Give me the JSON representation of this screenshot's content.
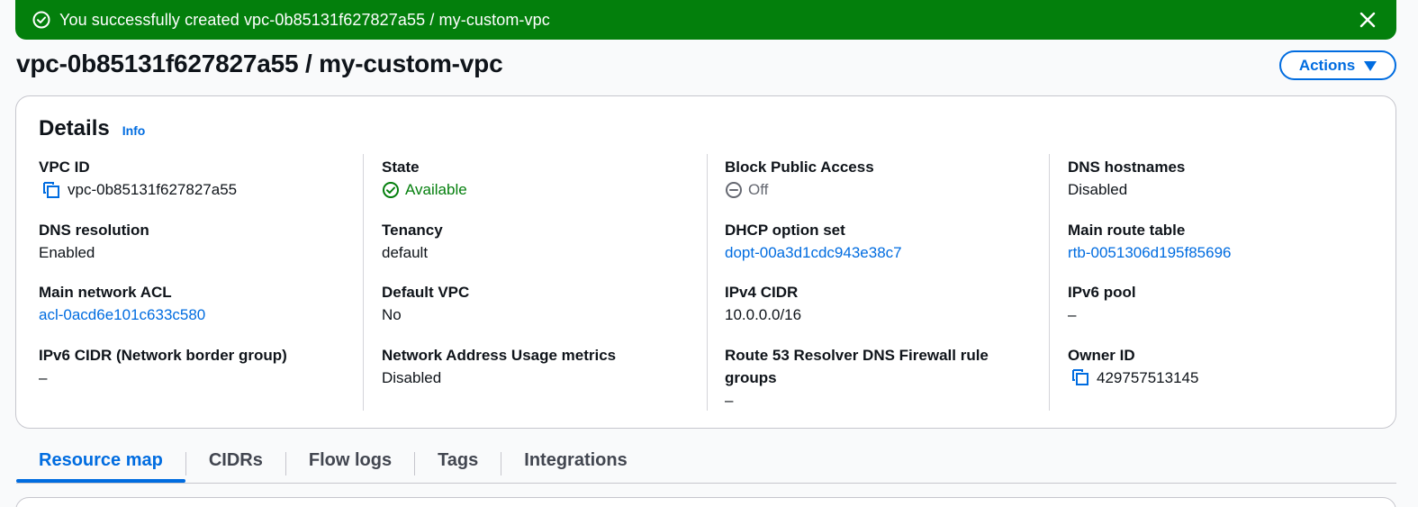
{
  "flash": {
    "message": "You successfully created vpc-0b85131f627827a55 / my-custom-vpc",
    "icon": "check-circle-icon",
    "close_icon": "close-icon",
    "color": "#037f0c"
  },
  "header": {
    "title": "vpc-0b85131f627827a55 / my-custom-vpc",
    "actions_label": "Actions"
  },
  "details": {
    "title": "Details",
    "info_label": "Info",
    "columns": [
      [
        {
          "label": "VPC ID",
          "value": "vpc-0b85131f627827a55"
        },
        {
          "label": "DNS resolution",
          "value": "Enabled"
        },
        {
          "label": "Main network ACL",
          "value": "acl-0acd6e101c633c580"
        },
        {
          "label": "IPv6 CIDR (Network border group)",
          "value": "–"
        }
      ],
      [
        {
          "label": "State",
          "value": "Available"
        },
        {
          "label": "Tenancy",
          "value": "default"
        },
        {
          "label": "Default VPC",
          "value": "No"
        },
        {
          "label": "Network Address Usage metrics",
          "value": "Disabled"
        }
      ],
      [
        {
          "label": "Block Public Access",
          "value": "Off"
        },
        {
          "label": "DHCP option set",
          "value": "dopt-00a3d1cdc943e38c7"
        },
        {
          "label": "IPv4 CIDR",
          "value": "10.0.0.0/16"
        },
        {
          "label": "Route 53 Resolver DNS Firewall rule",
          "label_line2": "groups",
          "value": "–"
        }
      ],
      [
        {
          "label": "DNS hostnames",
          "value": "Disabled"
        },
        {
          "label": "Main route table",
          "value": "rtb-0051306d195f85696"
        },
        {
          "label": "IPv6 pool",
          "value": "–"
        },
        {
          "label": "Owner ID",
          "value": "429757513145"
        }
      ]
    ]
  },
  "tabs": [
    {
      "label": "Resource map",
      "active": true
    },
    {
      "label": "CIDRs",
      "active": false
    },
    {
      "label": "Flow logs",
      "active": false
    },
    {
      "label": "Tags",
      "active": false
    },
    {
      "label": "Integrations",
      "active": false
    }
  ],
  "colors": {
    "link": "#006ce0",
    "success": "#037f0c",
    "muted": "#656871"
  }
}
